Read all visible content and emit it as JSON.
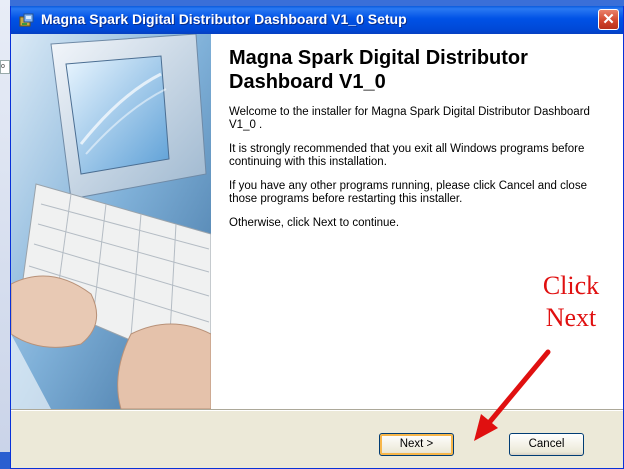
{
  "window": {
    "title": "Magna Spark Digital Distributor Dashboard V1_0 Setup",
    "close_label": "✕"
  },
  "content": {
    "heading": "Magna Spark Digital Distributor Dashboard V1_0",
    "paragraphs": [
      "Welcome to the installer for Magna Spark Digital Distributor Dashboard V1_0 .",
      "It is strongly recommended that you exit all Windows programs before continuing with this installation.",
      "If you have any other programs running, please click Cancel and close those programs before restarting this installer.",
      "Otherwise, click Next to continue."
    ]
  },
  "buttons": {
    "next_label": "Next >",
    "cancel_label": "Cancel"
  },
  "annotation": {
    "line1": "Click",
    "line2": "Next",
    "color": "#e01010"
  },
  "desktop": {
    "fragment_text": "o"
  },
  "icons": [
    "installer-icon",
    "close-icon",
    "keyboard-computer-illustration",
    "red-arrow-icon"
  ]
}
